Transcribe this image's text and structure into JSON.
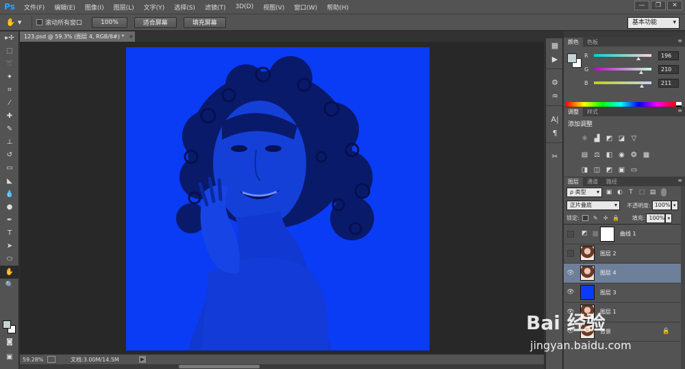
{
  "app": {
    "logo": "Ps"
  },
  "menu": [
    "文件(F)",
    "编辑(E)",
    "图像(I)",
    "图层(L)",
    "文字(Y)",
    "选择(S)",
    "滤镜(T)",
    "3D(D)",
    "视图(V)",
    "窗口(W)",
    "帮助(H)"
  ],
  "window_controls": {
    "minimize": "—",
    "restore": "❐",
    "close": "✕"
  },
  "options_bar": {
    "scroll_all_label": "滚动所有窗口",
    "zoom_100_label": "100%",
    "fit_screen_label": "适合屏幕",
    "fill_screen_label": "填充屏幕",
    "workspace": "基本功能"
  },
  "document": {
    "tab_title": "123.psd @ 59.3% (图层 4, RGB/8#) *",
    "tab_close": "×",
    "canvas_color": "#0a3cf5"
  },
  "status": {
    "zoom": "59.28%",
    "doc_info": "文档:3.00M/14.5M",
    "arrow": "▶"
  },
  "color_panel": {
    "tabs": [
      "颜色",
      "色板"
    ],
    "menu_glyph": "≡",
    "foreground": "#c4d2d3",
    "background": "#ffffff",
    "sliders": [
      {
        "label": "R",
        "value": "196",
        "level": 0.77
      },
      {
        "label": "G",
        "value": "210",
        "level": 0.82
      },
      {
        "label": "B",
        "value": "211",
        "level": 0.83
      }
    ]
  },
  "adjust_panel": {
    "tabs": [
      "调整",
      "样式"
    ],
    "title": "添加调整"
  },
  "layers_panel": {
    "tabs": [
      "图层",
      "通道",
      "路径"
    ],
    "filter_type": "ρ 类型",
    "blend_mode": "正片叠底",
    "opacity_label": "不透明度:",
    "opacity_value": "100%",
    "lock_label": "锁定:",
    "fill_label": "填充:",
    "fill_value": "100%",
    "layers": [
      {
        "name": "曲线 1",
        "visible": false,
        "thumb": "white",
        "adjustment": true,
        "selected": false
      },
      {
        "name": "图层 2",
        "visible": false,
        "thumb": "photo",
        "adjustment": false,
        "selected": false
      },
      {
        "name": "图层 4",
        "visible": true,
        "thumb": "photo",
        "adjustment": false,
        "selected": true
      },
      {
        "name": "图层 3",
        "visible": true,
        "thumb": "blue",
        "adjustment": false,
        "selected": false
      },
      {
        "name": "图层 1",
        "visible": true,
        "thumb": "photo",
        "adjustment": false,
        "selected": false
      },
      {
        "name": "背景",
        "visible": true,
        "thumb": "photo",
        "adjustment": false,
        "selected": false,
        "locked": true
      }
    ]
  },
  "watermark": {
    "brand": "Bai 经验",
    "url": "jingyan.baidu.com"
  }
}
